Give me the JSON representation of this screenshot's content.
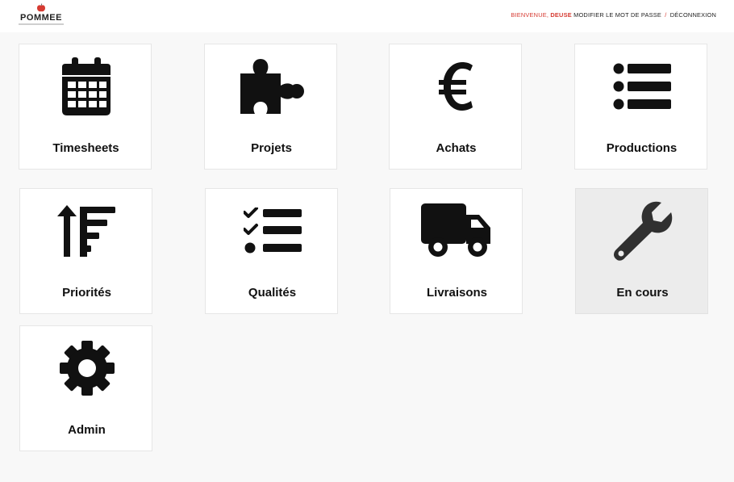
{
  "header": {
    "logo_text": "POMMEE",
    "welcome_label": "BIENVENUE,",
    "username": "DEUSE",
    "change_password": "MODIFIER LE MOT DE PASSE",
    "separator": "/",
    "logout": "DÉCONNEXION"
  },
  "colors": {
    "accent": "#d63b32",
    "tile_bg": "#ffffff",
    "tile_active_bg": "#ececec",
    "page_bg": "#f8f8f8"
  },
  "tiles": [
    {
      "label": "Timesheets",
      "icon": "calendar-icon"
    },
    {
      "label": "Projets",
      "icon": "puzzle-icon"
    },
    {
      "label": "Achats",
      "icon": "euro-icon"
    },
    {
      "label": "Productions",
      "icon": "list-icon"
    },
    {
      "label": "Priorités",
      "icon": "sort-priority-icon"
    },
    {
      "label": "Qualités",
      "icon": "checklist-icon"
    },
    {
      "label": "Livraisons",
      "icon": "truck-icon"
    },
    {
      "label": "En cours",
      "icon": "wrench-icon",
      "active": true
    },
    {
      "label": "Admin",
      "icon": "gear-icon"
    }
  ]
}
